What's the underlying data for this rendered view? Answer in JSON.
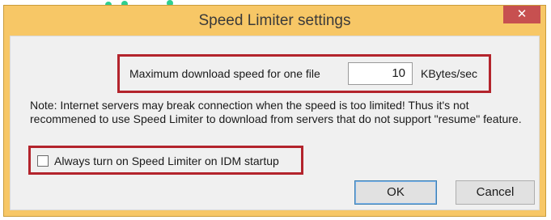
{
  "window": {
    "title": "Speed Limiter settings",
    "close_glyph": "✕"
  },
  "speed": {
    "label": "Maximum download speed for one file",
    "value": "10",
    "unit": "KBytes/sec"
  },
  "note": "Note: Internet servers may break connection when the speed is too limited! Thus it's not recommened to use Speed Limiter to download from servers that do not support \"resume\" feature.",
  "startup": {
    "label": "Always turn on Speed Limiter on IDM startup",
    "checked": false
  },
  "buttons": {
    "ok": "OK",
    "cancel": "Cancel"
  },
  "colors": {
    "titlebar": "#f7c766",
    "highlight_border": "#b3242c",
    "close_button": "#c75050"
  }
}
